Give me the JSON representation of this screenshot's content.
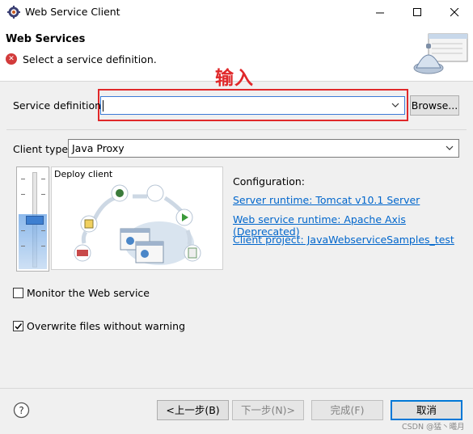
{
  "window": {
    "title": "Web Service Client"
  },
  "header": {
    "title": "Web Services",
    "message": "Select a service definition."
  },
  "annotation": {
    "text": "输入",
    "color": "#e0282a"
  },
  "service_definition": {
    "label": "Service definition:",
    "value": "",
    "browse_label": "Browse..."
  },
  "client_type": {
    "label": "Client type:",
    "value": "Java Proxy"
  },
  "graphic": {
    "title": "Deploy client"
  },
  "configuration": {
    "heading": "Configuration:",
    "links": [
      "Server runtime: Tomcat v10.1 Server",
      "Web service runtime: Apache Axis (Deprecated)",
      "Client project: JavaWebserviceSamples_test"
    ]
  },
  "options": [
    {
      "label": "Monitor the Web service",
      "checked": false
    },
    {
      "label": "Overwrite files without warning",
      "checked": true
    }
  ],
  "footer": {
    "back_label": "<上一步(B)",
    "next_label": "下一步(N)>",
    "finish_label": "完成(F)",
    "cancel_label": "取消",
    "watermark": "CSDN @猛丶曦月"
  },
  "colors": {
    "accent": "#0078d7",
    "link": "#0066cc",
    "error": "#d23b3b"
  },
  "icons": [
    "eclipse-gear-icon",
    "minimize-icon",
    "maximize-icon",
    "close-icon",
    "error-icon",
    "wizard-banner-icon",
    "dropdown-arrow-icon",
    "help-icon"
  ]
}
